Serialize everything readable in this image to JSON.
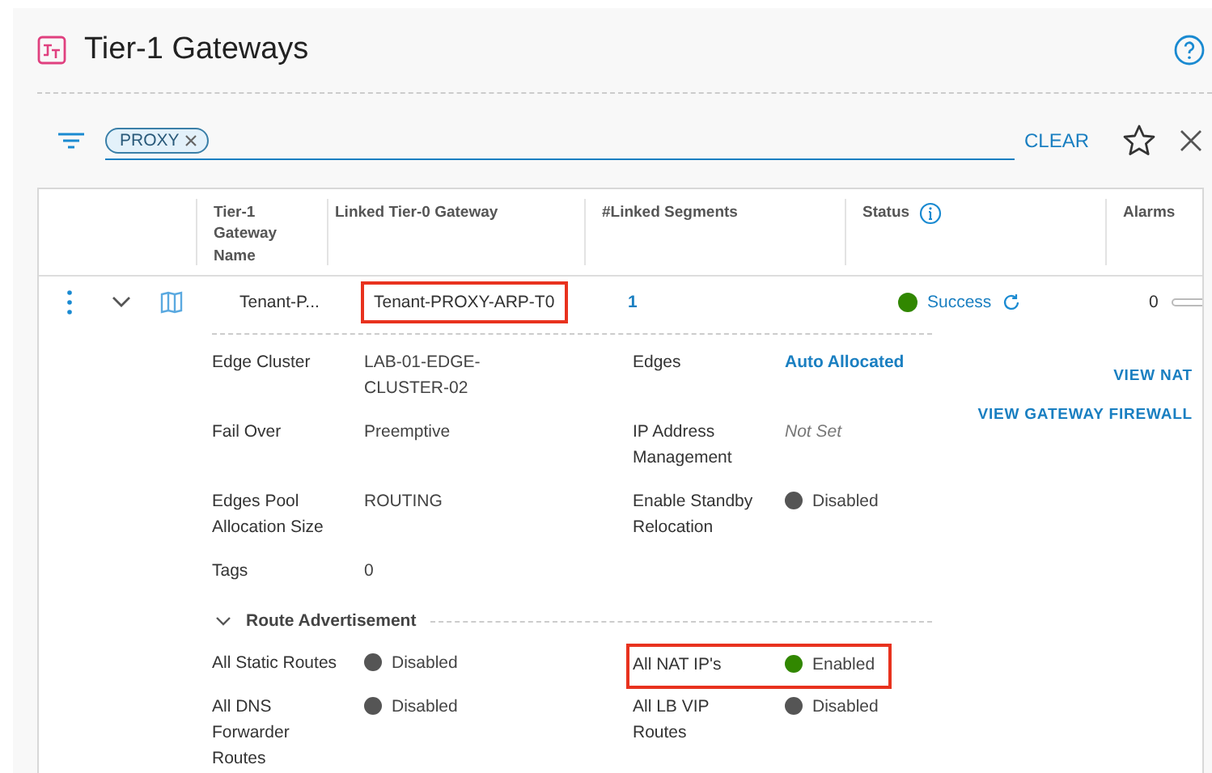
{
  "page": {
    "title": "Tier-1 Gateways"
  },
  "filter": {
    "chips": [
      {
        "label": "PROXY"
      }
    ],
    "clear": "CLEAR"
  },
  "table": {
    "columns": [
      "Tier-1 Gateway Name",
      "Linked Tier-0 Gateway",
      "#Linked Segments",
      "Status",
      "Alarms"
    ],
    "rows": [
      {
        "expanded": true,
        "name": "Tenant-P...",
        "tier0": "Tenant-PROXY-ARP-T0",
        "tier0_highlighted": true,
        "segments": "1",
        "status": "Success",
        "status_ok": true,
        "alarms": "0",
        "fields": [
          {
            "left": {
              "label": "Edge Cluster",
              "value": "LAB-01-EDGE-CLUSTER-02",
              "kind": "text"
            },
            "right": {
              "label": "Edges",
              "value": "Auto Allocated",
              "kind": "link"
            }
          },
          {
            "left": {
              "label": "Fail Over",
              "value": "Preemptive",
              "kind": "text"
            },
            "right": {
              "label": "IP Address Management",
              "value": "Not Set",
              "kind": "unset"
            }
          },
          {
            "left": {
              "label": "Edges Pool Allocation Size",
              "value": "ROUTING",
              "kind": "text"
            },
            "right": {
              "label": "Enable Standby Relocation",
              "value": "Disabled",
              "kind": "toggle",
              "enabled": false
            }
          },
          {
            "left": {
              "label": "Tags",
              "value": "0",
              "kind": "text"
            }
          }
        ],
        "actions": [
          "VIEW NAT",
          "VIEW GATEWAY FIREWALL"
        ],
        "route_advertisement": {
          "title": "Route Advertisement",
          "expanded": true,
          "items": [
            {
              "label": "All Static Routes",
              "value": "Disabled",
              "enabled": false,
              "highlighted": false
            },
            {
              "label": "All NAT IP's",
              "value": "Enabled",
              "enabled": true,
              "highlighted": true
            },
            {
              "label": "All DNS Forwarder Routes",
              "value": "Disabled",
              "enabled": false,
              "highlighted": false
            },
            {
              "label": "All LB VIP Routes",
              "value": "Disabled",
              "enabled": false,
              "highlighted": false
            }
          ]
        }
      }
    ]
  }
}
